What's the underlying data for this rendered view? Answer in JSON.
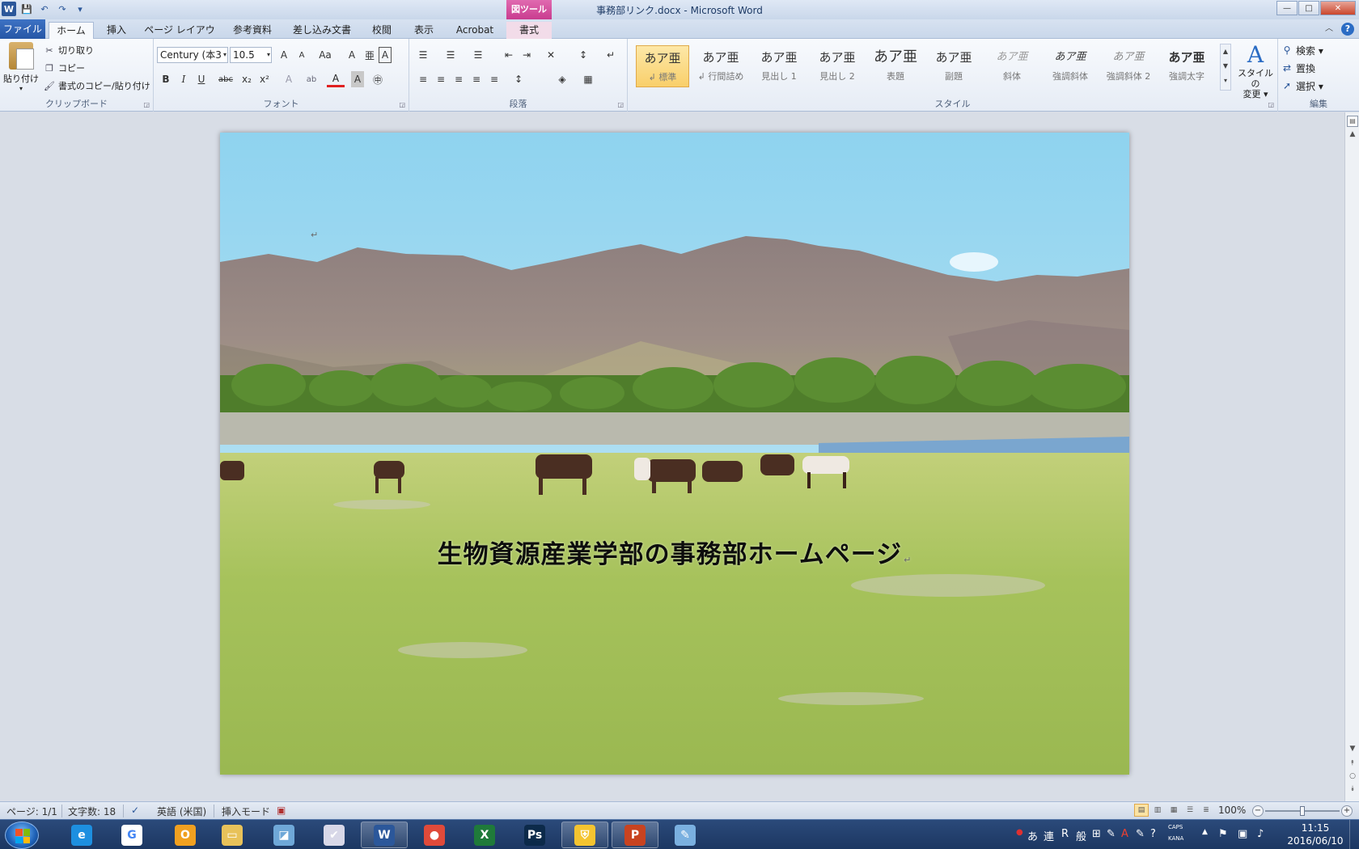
{
  "window": {
    "title": "事務部リンク.docx - Microsoft Word",
    "contextual_group": "図ツール",
    "controls": {
      "minimize": "—",
      "maximize": "□",
      "close": "✕"
    }
  },
  "qat": {
    "app_icon": "W",
    "save": "💾",
    "undo": "↶",
    "redo": "↷",
    "customize": "▾"
  },
  "tabs": {
    "file": "ファイル",
    "home": "ホーム",
    "insert": "挿入",
    "page_layout": "ページ レイアウト",
    "references": "参考資料",
    "mailings": "差し込み文書",
    "review": "校閲",
    "view": "表示",
    "acrobat": "Acrobat",
    "format": "書式"
  },
  "clipboard": {
    "label": "クリップボード",
    "paste": "貼り付け",
    "cut": "切り取り",
    "copy": "コピー",
    "format_painter": "書式のコピー/貼り付け"
  },
  "font": {
    "label": "フォント",
    "name": "Century (本3",
    "size": "10.5",
    "bold": "B",
    "italic": "I",
    "underline": "U",
    "strike": "abc",
    "subscript": "x₂",
    "superscript": "x²",
    "grow": "A",
    "shrink": "A",
    "change_case": "Aa",
    "clear": "A",
    "phonetic": "亜",
    "char_border": "A",
    "text_effects": "A",
    "highlight": "ab",
    "font_color": "A",
    "char_shading": "A",
    "enclose": "㊥"
  },
  "paragraph": {
    "label": "段落",
    "bullets": "☰",
    "numbering": "☰",
    "multilevel": "☰",
    "decrease_indent": "⇤",
    "increase_indent": "⇥",
    "asian_layout": "✕",
    "sort": "↕",
    "show_marks": "↵",
    "align_left": "≡",
    "center": "≡",
    "align_right": "≡",
    "justify": "≡",
    "distributed": "≡",
    "line_spacing": "↕",
    "shading": "◈",
    "borders": "▦"
  },
  "styles": {
    "label": "スタイル",
    "items": [
      {
        "preview": "あア亜",
        "name": "↲ 標準"
      },
      {
        "preview": "あア亜",
        "name": "↲ 行間詰め"
      },
      {
        "preview": "あア亜",
        "name": "見出し 1"
      },
      {
        "preview": "あア亜",
        "name": "見出し 2"
      },
      {
        "preview": "あア亜",
        "name": "表題"
      },
      {
        "preview": "あア亜",
        "name": "副題"
      },
      {
        "preview": "あア亜",
        "name": "斜体"
      },
      {
        "preview": "あア亜",
        "name": "強調斜体"
      },
      {
        "preview": "あア亜",
        "name": "強調斜体 2"
      },
      {
        "preview": "あア亜",
        "name": "強調太字"
      }
    ],
    "change_styles": "スタイルの\n変更 ▾",
    "change_styles_icon": "A"
  },
  "editing": {
    "label": "編集",
    "find": "検索 ▾",
    "replace": "置換",
    "select": "選択 ▾"
  },
  "document": {
    "heading": "生物資源産業学部の事務部ホームページ",
    "paragraph_mark": "↵"
  },
  "statusbar": {
    "page": "ページ: 1/1",
    "word_count": "文字数: 18",
    "language": "英語 (米国)",
    "mode": "挿入モード",
    "zoom": "100%",
    "zoom_minus": "−",
    "zoom_plus": "+",
    "zoom_fraction": 0.5
  },
  "taskbar": {
    "apps": [
      {
        "name": "ie",
        "glyph": "e",
        "color": "#1d8fe0"
      },
      {
        "name": "google",
        "glyph": "G",
        "color": "#ffffff"
      },
      {
        "name": "outlook",
        "glyph": "O",
        "color": "#f0a020"
      },
      {
        "name": "explorer",
        "glyph": "▭",
        "color": "#e8c25a"
      },
      {
        "name": "notebook",
        "glyph": "◪",
        "color": "#6fa8d8"
      },
      {
        "name": "scheduler",
        "glyph": "✔",
        "color": "#d8d8e8"
      },
      {
        "name": "word",
        "glyph": "W",
        "color": "#2b579a"
      },
      {
        "name": "chrome",
        "glyph": "●",
        "color": "#e04a3a"
      },
      {
        "name": "excel",
        "glyph": "X",
        "color": "#1f7a3a"
      },
      {
        "name": "photoshop",
        "glyph": "Ps",
        "color": "#0c2a4a"
      },
      {
        "name": "security",
        "glyph": "⛨",
        "color": "#f4c430"
      },
      {
        "name": "powerpoint",
        "glyph": "P",
        "color": "#c84320"
      },
      {
        "name": "paint",
        "glyph": "✎",
        "color": "#7ab0e0"
      }
    ],
    "ime": {
      "rec": "●",
      "hiragana": "あ",
      "ren": "連",
      "r": "R",
      "mode": "般",
      "icon_a": "⊞",
      "icon_b": "✎",
      "icon_c": "A",
      "icon_d": "✎",
      "help": "?",
      "caps": "CAPS",
      "kana": "KANA"
    },
    "tray_arrow": "▲",
    "time": "11:15",
    "date": "2016/06/10"
  }
}
